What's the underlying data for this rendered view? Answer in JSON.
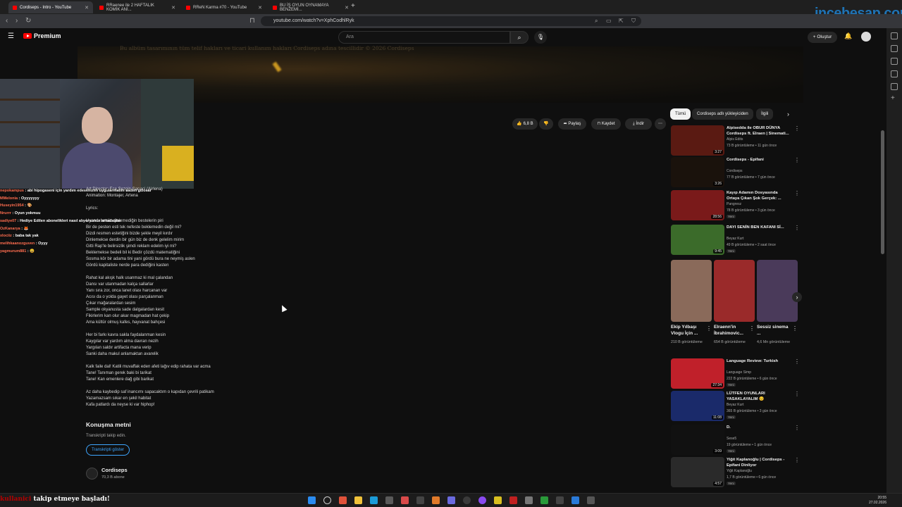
{
  "browser": {
    "tabs": [
      {
        "label": "Cordiseps - Intro - YouTube",
        "active": true
      },
      {
        "label": "RRaenee ile 2 HAFTALIK KOMİK ANİ...",
        "active": false
      },
      {
        "label": "RReN Karma #70 - YouTube",
        "active": false
      },
      {
        "label": "BU İŞ OYUN OYNAMAYA BENZEMİ...",
        "active": false
      }
    ],
    "url": "youtube.com/watch?v=XphCodhlRyk"
  },
  "header": {
    "logo": "Premium",
    "search_placeholder": "Ara",
    "create_label": "Oluştur"
  },
  "watermark": "incebesap.com",
  "banner_text": "Bu albüm tasarımının tüm telif hakları ve ticari kullanım hakları Cordiseps adına tescillidir © 2026 Cordiseps",
  "actions": {
    "likes": "6,8 B",
    "share": "Paylaş",
    "save": "Kaydet",
    "download": "İndir"
  },
  "chat": [
    {
      "user": "nepokampus",
      "text": "abi hipogaseni için yardım edesenizim uygularmatım sadim gizosar"
    },
    {
      "user": "MMelonia",
      "text": "Oyyyyyyy"
    },
    {
      "user": "Huseyin1954",
      "text": "🎨"
    },
    {
      "user": "Nrurrr",
      "text": "Oyun yokmuu"
    },
    {
      "user": "sadiye07",
      "text": "Hediye Edilen abonelikleri nasıl alıyorsunuz arkadaşlar"
    },
    {
      "user": "OzKanarya",
      "text": "🦊"
    },
    {
      "user": "xlociiz",
      "text": "baba tak yak"
    },
    {
      "user": "melihkaanozguven",
      "text": "Oyyy"
    },
    {
      "user": "yagmurum881",
      "text": "😄"
    }
  ],
  "description": {
    "credits": [
      "Art Director: Ece Sezgin Sarıaci (Airlena)",
      "Animation: Montajer, Artena"
    ],
    "lyrics_label": "Lyrics:",
    "stanzas": [
      [
        "Uyandı henüz dinlemediğin bestelerin piri",
        "Bir de pesten esti tek nefeste beklemedin değil mi?",
        "Dizdi resmen estetiğini bizde şekle meyil kırdır",
        "Dinlemekse derdin bir gün biz de denk gelelim mirim",
        "Gitti Rap'le belirsizlik şimdi reklam edelim iyi mi?",
        "Beklemekse bedeli bil ki Bedir çözdü matematiğini",
        "Sosma kör bir adama tini yani gördü bura ne neymiş aslen",
        "Gördü kapitaliste nerde para dediğini kasten"
      ],
      [
        "Rahat kal akışk halk usanmaz ki mal çalandan",
        "Dansı var utanmadan kalça sallarlar",
        "Yanı sıra zor, onca lanet olası harcanan var",
        "Acısı da o yolda gayet olası parçalanman",
        "Çıkar mağaralardan sesim",
        "Sample okyanusta sade dalgalardan kesit",
        "Fikirlerim kan olur akar magmadan hat çekip",
        "Ama kültür olmuş kafes, hayvanat bahçesi"
      ],
      [
        "Her bi farkı kavra sakla faydalanman kesin",
        "Kaygılar var yardım alma davran nezih",
        "Yargılan saldır artifacta mana verip",
        "Sanki daha makul anlamaktan avarelik"
      ],
      [
        "Kalk faile dal! Katili muvaffak eden afeti lağıv edip rahata var acma",
        "Tane! Tanıman gerek baki bi tarikat",
        "Tane! Kan emenlere dağ gibi barikat"
      ],
      [
        "Az daha kaybedip saf inancımı sapacaktım o kapıdan çevrili patikam",
        "Yazamazsam sıkar en şekil habitat",
        "Kafa patlardı da neyse ki var hiphop!"
      ]
    ]
  },
  "transcript": {
    "title": "Konuşma metni",
    "subtitle": "Transkripti takip edin.",
    "button": "Transkripti göster"
  },
  "channel": {
    "name": "Cordiseps",
    "subs": "70,3 B abone"
  },
  "chips": [
    "Tümü",
    "Cordiseps adlı yükleyiciden",
    "İlgili"
  ],
  "recommendations": [
    {
      "title": "Alpisedda ile OBUR DÜNYA",
      "title2": "Cordiseps ft. Elraen | Sinemati...",
      "channel": "Alpis Edits",
      "meta": "73 B görüntüleme • 11 gün önce",
      "duration": "3:27",
      "new": false,
      "color": "#5a1a12"
    },
    {
      "title": "Cordiseps - Epifani",
      "title2": "",
      "channel": "Cordiseps",
      "meta": "77 B görüntüleme • 7 gün önce",
      "duration": "3:26",
      "new": false,
      "color": "#1a120c"
    },
    {
      "title": "Kayıp Adamın Dosyasında",
      "title2": "Ortaya Çıkan Şok Gerçek: ...",
      "channel": "Pangresz",
      "meta": "78 B görüntüleme • 3 gün önce",
      "duration": "28:56",
      "new": true,
      "color": "#7a1a1a"
    },
    {
      "title": "DAYI SENİN BEN KAFANI Sİ...",
      "title2": "",
      "channel": "Beyaz Kurt",
      "meta": "49 B görüntüleme • 2 saat önce",
      "duration": "9:45",
      "new": true,
      "color": "#3b6b2a"
    }
  ],
  "shorts": [
    {
      "title": "Ekip Yılbaşı Vlogu İçin ...",
      "views": "210 B görüntüleme",
      "color": "#8a6a5a"
    },
    {
      "title": "Elraenn'in İbrahimovic...",
      "views": "654 B görüntüleme",
      "color": "#9a2a2a"
    },
    {
      "title": "Sessiz sinema ...",
      "views": "4,6 Mn görüntüleme",
      "color": "#4a3a5a"
    }
  ],
  "recommendations2": [
    {
      "title": "Language Review: Turkish",
      "title2": "",
      "channel": "Language Simp",
      "meta": "222 B görüntüleme • 6 gün önce",
      "duration": "27:34",
      "new": true,
      "color": "#c0202a"
    },
    {
      "title": "LÜTFEN OYUNLARI",
      "title2": "YASAKLAYALIM 😊",
      "channel": "Beyaz Kurt",
      "meta": "365 B görüntüleme • 3 gün önce",
      "duration": "11:08",
      "new": true,
      "color": "#1a2a6a"
    },
    {
      "title": "D.",
      "title2": "",
      "channel": "Sese5",
      "meta": "19 görüntüleme • 1 gün önce",
      "duration": "3:09",
      "new": true,
      "color": "#111111"
    },
    {
      "title": "Yiğit Kaplanoğlu | Cordiseps -",
      "title2": "Epifani Dinliyor",
      "channel": "Yiğit Kaplanoğlu",
      "meta": "1,7 B görüntüleme • 6 gün önce",
      "duration": "4:57",
      "new": true,
      "color": "#2a2a2a"
    }
  ],
  "follow_alert": {
    "name": "kullanici",
    "text": " takip etmeye başladı!"
  },
  "tray": {
    "time": "20:55",
    "date": "27.02.2026"
  }
}
